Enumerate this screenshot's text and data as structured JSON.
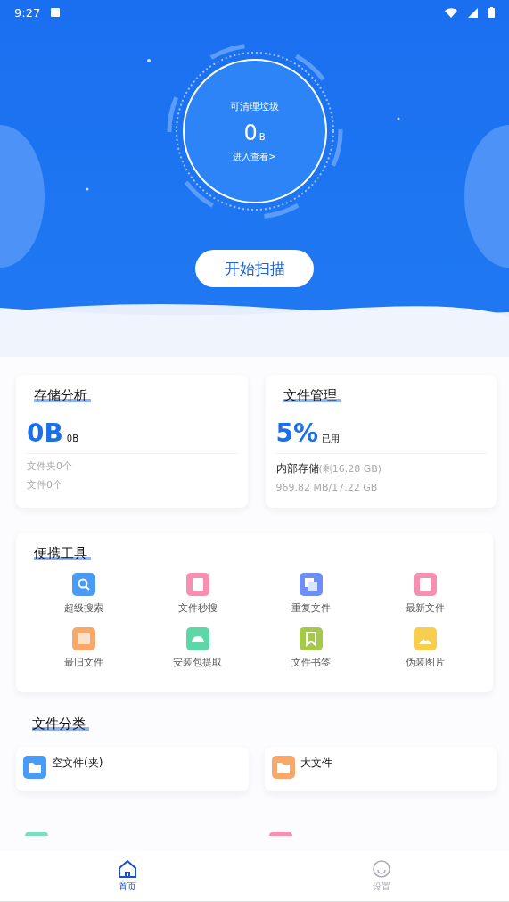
{
  "status_bar": {
    "time": "9:27"
  },
  "cleaner": {
    "label": "可清理垃圾",
    "amount": "0",
    "unit": "B",
    "link": "进入查看>",
    "button": "开始扫描"
  },
  "storage_analysis": {
    "title": "存储分析",
    "size": "0B",
    "size_unit": "0B",
    "lines": [
      "文件夹0个",
      "文件0个"
    ]
  },
  "file_management": {
    "title": "文件管理",
    "percent": "5%",
    "percent_label": "已用",
    "storage_name": "内部存储",
    "storage_free": "(剩16.28 GB)",
    "usage": "969.82 MB/17.22 GB"
  },
  "tools": {
    "title": "便携工具",
    "items": [
      {
        "label": "超级搜索",
        "kind": "search",
        "color": "#4a9bf5"
      },
      {
        "label": "文件秒搜",
        "kind": "doc",
        "color": "#f78fb0"
      },
      {
        "label": "重复文件",
        "kind": "copy",
        "color": "#6d8ff5"
      },
      {
        "label": "最新文件",
        "kind": "new",
        "color": "#f78fb0"
      },
      {
        "label": "最旧文件",
        "kind": "box",
        "color": "#f8a86a"
      },
      {
        "label": "安装包提取",
        "kind": "android",
        "color": "#5fd6a8"
      },
      {
        "label": "文件书签",
        "kind": "bookmark",
        "color": "#a5c94a"
      },
      {
        "label": "伪装图片",
        "kind": "image",
        "color": "#f7cf4e"
      }
    ]
  },
  "categories": {
    "title": "文件分类",
    "items": [
      {
        "label": "空文件(夹)",
        "kind": "folder",
        "color": "#4a9bf5"
      },
      {
        "label": "大文件",
        "kind": "folder",
        "color": "#f8a86a"
      }
    ],
    "partial_items": [
      {
        "color": "#7fdcc0"
      },
      {
        "color": "#f78fb0"
      }
    ]
  },
  "bottom_nav": [
    {
      "label": "首页",
      "kind": "home",
      "selected": true
    },
    {
      "label": "设置",
      "kind": "smile",
      "selected": false
    }
  ]
}
